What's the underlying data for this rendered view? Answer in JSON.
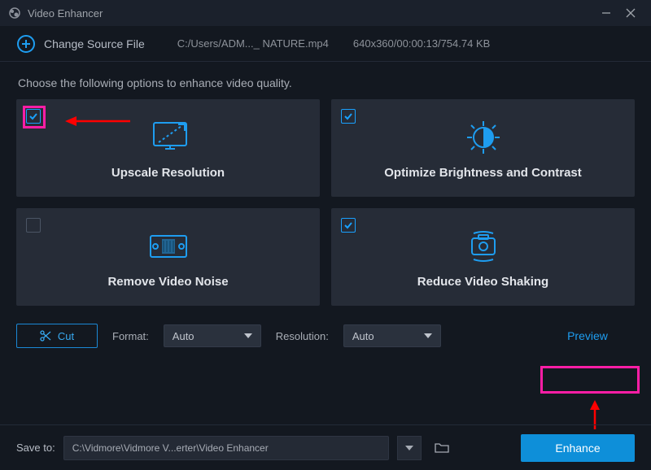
{
  "titlebar": {
    "app_name": "Video Enhancer"
  },
  "topbar": {
    "change_source": "Change Source File",
    "file_path": "C:/Users/ADM..._ NATURE.mp4",
    "meta": "640x360/00:00:13/754.74 KB"
  },
  "instruction": "Choose the following options to enhance video quality.",
  "cards": {
    "upscale": {
      "title": "Upscale Resolution",
      "checked": true,
      "highlighted": true
    },
    "brightness": {
      "title": "Optimize Brightness and Contrast",
      "checked": true
    },
    "noise": {
      "title": "Remove Video Noise",
      "checked": false
    },
    "shaking": {
      "title": "Reduce Video Shaking",
      "checked": true
    }
  },
  "controls": {
    "cut_label": "Cut",
    "format_label": "Format:",
    "format_value": "Auto",
    "resolution_label": "Resolution:",
    "resolution_value": "Auto",
    "preview_label": "Preview"
  },
  "footer": {
    "saveto_label": "Save to:",
    "saveto_path": "C:\\Vidmore\\Vidmore V...erter\\Video Enhancer",
    "enhance_label": "Enhance"
  }
}
